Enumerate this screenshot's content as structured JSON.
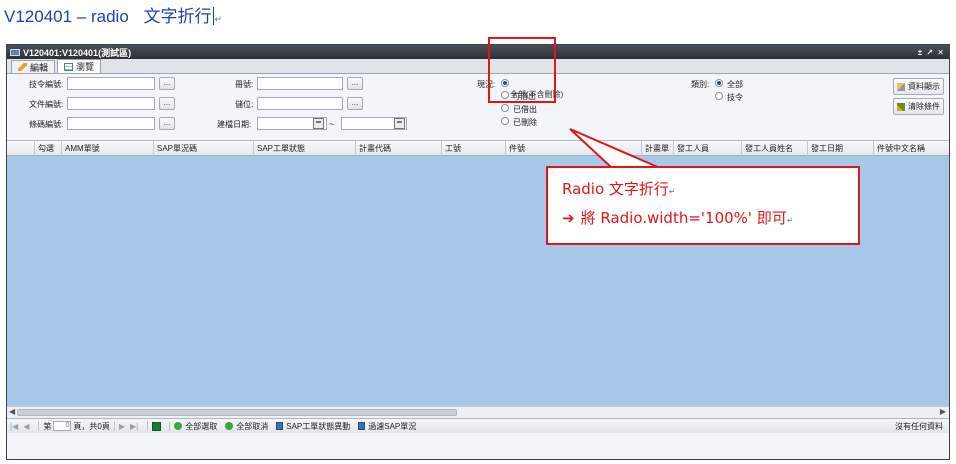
{
  "doc": {
    "title_code": "V120401 – radio",
    "title_zh": "文字折行",
    "para_mark": "↵"
  },
  "window": {
    "title": "V120401:V120401(測試區)",
    "controls": "± ↗ ✕"
  },
  "tabs": [
    {
      "label": "編輯",
      "icon": "pencil-icon"
    },
    {
      "label": "瀏覽",
      "icon": "table-icon"
    }
  ],
  "form": {
    "label_tech": "技令編號:",
    "label_doc": "文件編號:",
    "label_item": "條碼編號:",
    "label_book": "冊號:",
    "label_loc": "儲位:",
    "label_date": "建檔日期:",
    "browse_btn": "...",
    "tilde": "~",
    "status_label": "現況:",
    "status_options": [
      "全部(不含刪除)",
      "可借出",
      "已借出",
      "已刪除"
    ],
    "category_label": "類別:",
    "category_options": [
      "全部",
      "技令"
    ],
    "btn_show": "資料顯示",
    "btn_clear": "清除條件"
  },
  "grid": {
    "columns": [
      "勾選",
      "AMM單號",
      "SAP單況碼",
      "SAP工單狀態",
      "計畫代碼",
      "工號",
      "件號",
      "計畫單",
      "發工人員",
      "發工人員姓名",
      "發工日期",
      "件號中文名稱"
    ]
  },
  "pager": {
    "page_label": "第",
    "page_value": "0",
    "page_total": "頁，共0頁",
    "select_all": "全部選取",
    "deselect_all": "全部取消",
    "sap_status": "SAP工單狀態異動",
    "filter_sap": "過濾SAP單況",
    "no_data": "沒有任何資料"
  },
  "callout": {
    "line1": "Radio 文字折行",
    "line2": "將 Radio.width='100%'  即可",
    "arrow": "➔"
  },
  "colors": {
    "accent_red": "#e0161b",
    "title_blue": "#1f3fb8",
    "grid_body": "#a7c8e8"
  }
}
